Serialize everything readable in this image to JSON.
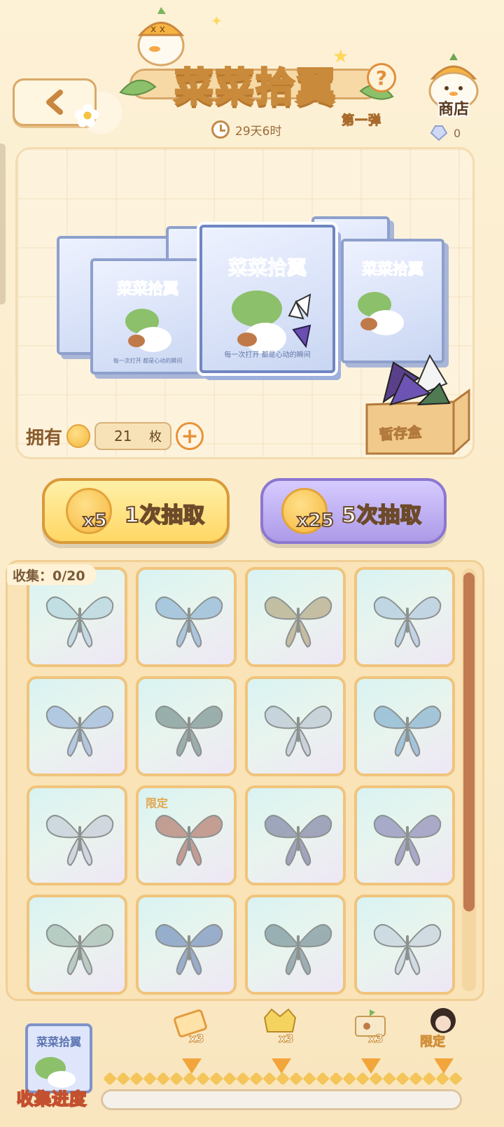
{
  "header": {
    "title": "菜菜拾翼",
    "subtitle": "第一弹",
    "help_label": "?",
    "timer": "29天6时",
    "shop_label": "商店",
    "gem_count": "0"
  },
  "showcase": {
    "box_title": "菜菜拾翼",
    "box_caption": "每一次打开 都是心动的瞬间",
    "storage_label": "暂存盒",
    "own_label": "拥有",
    "own_count": "21",
    "own_unit": "枚",
    "plus_label": "+"
  },
  "draws": {
    "single": {
      "multiplier": "x5",
      "label": "1次抽取"
    },
    "five": {
      "multiplier": "x25",
      "label": "5次抽取"
    }
  },
  "collection": {
    "label": "收集：0/20",
    "items": [
      {
        "tag": "",
        "color": "#9ec7d8"
      },
      {
        "tag": "",
        "color": "#6d9ccc"
      },
      {
        "tag": "",
        "color": "#a08a58"
      },
      {
        "tag": "",
        "color": "#9bb8d8"
      },
      {
        "tag": "",
        "color": "#7fa0d4"
      },
      {
        "tag": "",
        "color": "#4e6d6a"
      },
      {
        "tag": "",
        "color": "#aab6c8"
      },
      {
        "tag": "",
        "color": "#5f98c4"
      },
      {
        "tag": "",
        "color": "#b8bdd0"
      },
      {
        "tag": "限定",
        "color": "#a04a3a"
      },
      {
        "tag": "",
        "color": "#5a5a8a"
      },
      {
        "tag": "",
        "color": "#6c62a4"
      },
      {
        "tag": "",
        "color": "#8aa89a"
      },
      {
        "tag": "",
        "color": "#4a6aa8"
      },
      {
        "tag": "",
        "color": "#4f6e78"
      },
      {
        "tag": "",
        "color": "#b8c6d6"
      }
    ]
  },
  "progress": {
    "label": "收集进度",
    "milestones": [
      {
        "qty": "x3",
        "kind": "ticket"
      },
      {
        "qty": "x3",
        "kind": "crown"
      },
      {
        "qty": "x3",
        "kind": "box"
      },
      {
        "qty": "限定",
        "kind": "avatar"
      }
    ]
  },
  "colors": {
    "background": "#fbeccb",
    "accent_orange": "#e8923a",
    "gold_button": "#ffd765",
    "purple_button": "#ad9ae8",
    "progress_fill": "#f5f1ea"
  }
}
